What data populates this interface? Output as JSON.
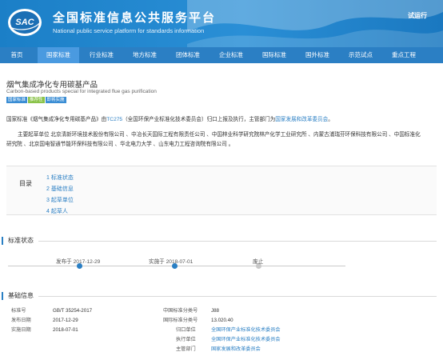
{
  "header": {
    "logo_text": "SAC",
    "title": "全国标准信息公共服务平台",
    "subtitle": "National public service platform  for standards information",
    "trial": "试运行"
  },
  "nav": {
    "items": [
      {
        "label": "首页"
      },
      {
        "label": "国家标准"
      },
      {
        "label": "行业标准"
      },
      {
        "label": "地方标准"
      },
      {
        "label": "团体标准"
      },
      {
        "label": "企业标准"
      },
      {
        "label": "国际标准"
      },
      {
        "label": "国外标准"
      },
      {
        "label": "示范试点"
      },
      {
        "label": "重点工程"
      }
    ],
    "active_index": 1
  },
  "standard": {
    "title": "烟气集成净化专用碳基产品",
    "title_en": "Carbon-based products special for integrated flue gas purification",
    "badges": [
      "国家标准",
      "推荐性",
      "即将实施"
    ]
  },
  "intro": {
    "p1_a": "国家标准《烟气集成净化专用碳基产品》由",
    "p1_link1": "TC275",
    "p1_b": "（全国环保产业标准化技术委员会）归口上报及执行，主管部门为",
    "p1_link2": "国家发展和改革委员会",
    "p1_c": "。",
    "p2_line1": "主要起草单位 北京清新环境技术股份有限公司 、中冶长天国际工程有限责任公司 、中国林业科学研究院林产化学工业研究所 、内蒙古浦瑞芬环保科技有限公司 、中国标准化",
    "p2_line2": "研究院 、北京国电智通节能环保科技有限公司 、华北电力大学 、山东电力工程咨询院有限公司 。"
  },
  "toc": {
    "label": "目录",
    "items": [
      "1  标准状态",
      "2  基础信息",
      "3  起草单位",
      "4  起草人"
    ]
  },
  "status": {
    "heading": "标准状态",
    "published": "发布于 2017-12-29",
    "implemented": "实施于 2018-07-01",
    "abolished": "废止"
  },
  "basic": {
    "heading": "基础信息",
    "rows": [
      {
        "k1": "标准号",
        "v1": "GB/T 35254-2017",
        "k2": "中国标准分类号",
        "v2": "J88"
      },
      {
        "k1": "发布日期",
        "v1": "2017-12-29",
        "k2": "国际标准分类号",
        "v2": "13.020.40"
      },
      {
        "k1": "实施日期",
        "v1": "2018-07-01",
        "k2": "归口单位",
        "v2": "全国环保产业标准化技术委员会"
      },
      {
        "k1": "",
        "v1": "",
        "k2": "执行单位",
        "v2": "全国环保产业标准化技术委员会"
      },
      {
        "k1": "",
        "v1": "",
        "k2": "主管部门",
        "v2": "国家发展和改革委员会"
      }
    ]
  },
  "colors": {
    "header_blue": "#1b7fc7",
    "nav_blue": "#2b7fc4",
    "nav_active": "#4a9ae0",
    "link_blue": "#2a7fc4",
    "timeline_done": "#2a7fc4",
    "timeline_pending": "#c9c9c9"
  }
}
